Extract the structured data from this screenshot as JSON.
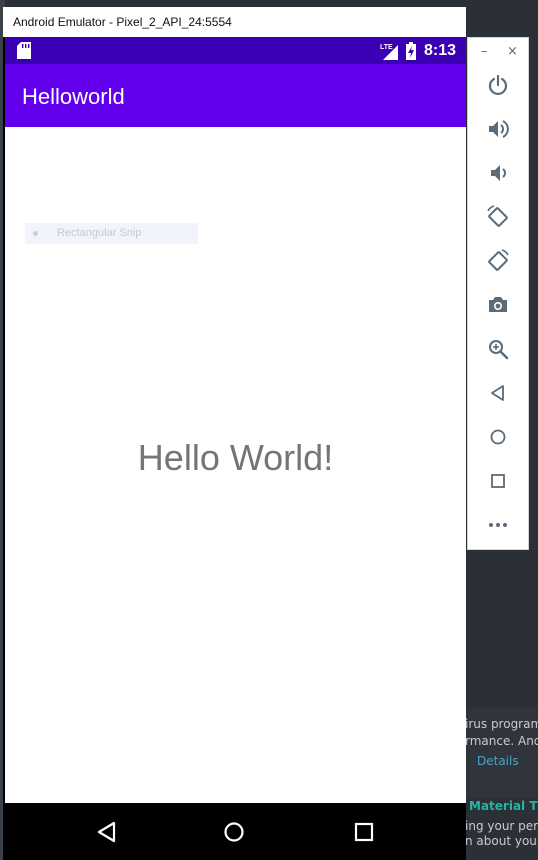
{
  "window": {
    "title": "Android Emulator - Pixel_2_API_24:5554"
  },
  "status_bar": {
    "network": "LTE",
    "time": "8:13"
  },
  "app_bar": {
    "title": "Helloworld"
  },
  "content": {
    "overlay_label": "Rectangular Snip",
    "greeting": "Hello World!"
  },
  "toolbar": {
    "minimize": "–",
    "close": "×",
    "items": [
      "power-icon",
      "volume-up-icon",
      "volume-down-icon",
      "rotate-left-icon",
      "rotate-right-icon",
      "camera-icon",
      "zoom-icon",
      "back-icon",
      "home-icon",
      "overview-icon",
      "more-icon"
    ]
  },
  "background": {
    "notify_lines": [
      "irus program",
      "rmance. Andr"
    ],
    "notify_link": "Details",
    "notify2_title": "Material The",
    "notify2_lines": [
      "ing your perm",
      "n about your c"
    ]
  },
  "colors": {
    "status_bar": "#3c00b4",
    "app_bar": "#6200ee",
    "greeting_text": "#757575",
    "toolbar_icon": "#5c6b78"
  }
}
